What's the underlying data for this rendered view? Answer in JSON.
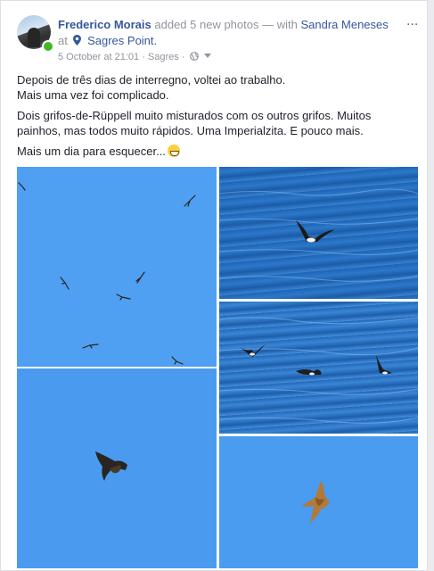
{
  "post": {
    "author": "Frederico Morais",
    "action": "added 5 new photos",
    "with_prefix": "— with",
    "tagged": "Sandra Meneses",
    "at_prefix": "at",
    "location": "Sagres Point.",
    "timestamp": "5 October at 21:01",
    "separator": "·",
    "place": "Sagres",
    "options": "...",
    "paragraphs": [
      "Depois de três dias de interregno, voltei ao trabalho.",
      "Mais uma vez foi complicado.",
      "Dois grifos-de-Rüppell muito misturados com os outros grifos. Muitos painhos, mas todos muito rápidos. Uma Imperialzita. E pouco mais.",
      "Mais um dia para esquecer..."
    ]
  },
  "icons": {
    "avatar": "profile-avatar",
    "online": "online-status-dot",
    "location": "map-pin-icon",
    "privacy": "globe-icon",
    "privacy_menu": "caret-down-icon",
    "emoji": "grinning-emoji",
    "options": "options-icon"
  },
  "photos": [
    {
      "name": "vultures-in-sky-photo"
    },
    {
      "name": "vulture-close-photo"
    },
    {
      "name": "petrel-on-water-photo"
    },
    {
      "name": "petrels-flock-photo"
    },
    {
      "name": "eagle-in-flight-photo"
    }
  ],
  "colors": {
    "link": "#365899",
    "secondary": "#90949c",
    "online": "#42b72a"
  }
}
